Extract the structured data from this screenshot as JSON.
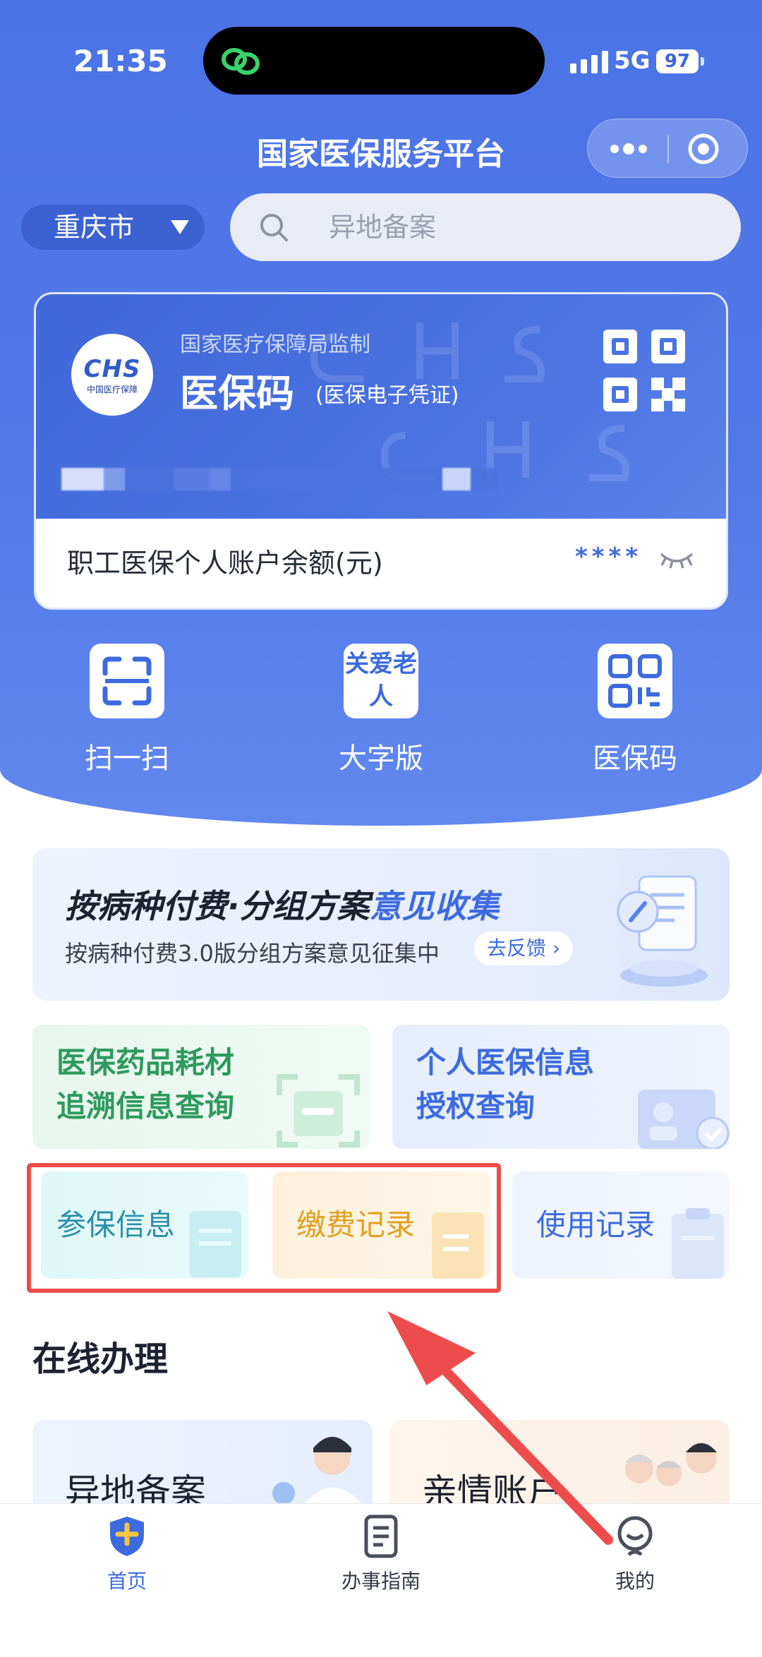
{
  "status_bar": {
    "time": "21:35",
    "network": "5G",
    "battery": "97"
  },
  "header": {
    "title": "国家医保服务平台"
  },
  "location": {
    "city": "重庆市"
  },
  "search": {
    "placeholder": "异地备案"
  },
  "card": {
    "supervisor": "国家医疗保障局监制",
    "title": "医保码",
    "subtitle": "(医保电子凭证)",
    "logo_text": "CHS",
    "logo_sub": "中国医疗保障",
    "balance_label": "职工医保个人账户余额(元)",
    "balance_value": "****"
  },
  "quick_actions": [
    {
      "label": "扫一扫",
      "icon": "scan-icon"
    },
    {
      "label": "大字版",
      "icon": "elder-care-icon",
      "icon_text": "关爱老人"
    },
    {
      "label": "医保码",
      "icon": "qr-code-icon"
    }
  ],
  "banner": {
    "title_main": "按病种付费·分组方案",
    "title_highlight": "意见收集",
    "subtitle": "按病种付费3.0版分组方案意见征集中",
    "button": "去反馈 ›"
  },
  "tiles": {
    "drug_trace": "医保药品耗材追溯信息查询",
    "drug_trace_lines": [
      "医保药品耗材",
      "追溯信息查询"
    ],
    "personal_auth_lines": [
      "个人医保信息",
      "授权查询"
    ],
    "insurance_info": "参保信息",
    "payment_records": "缴费记录",
    "usage_records": "使用记录"
  },
  "online": {
    "section_title": "在线办理",
    "items": [
      {
        "label": "异地备案"
      },
      {
        "label": "亲情账户"
      }
    ]
  },
  "tabbar": {
    "items": [
      {
        "label": "首页",
        "icon": "home-shield-icon",
        "active": true
      },
      {
        "label": "办事指南",
        "icon": "document-icon",
        "active": false
      },
      {
        "label": "我的",
        "icon": "profile-icon",
        "active": false
      }
    ]
  },
  "colors": {
    "primary": "#3d6bdf",
    "accent_red": "#ee4c4c",
    "orange": "#e0a020",
    "green": "#2e9a5c"
  }
}
